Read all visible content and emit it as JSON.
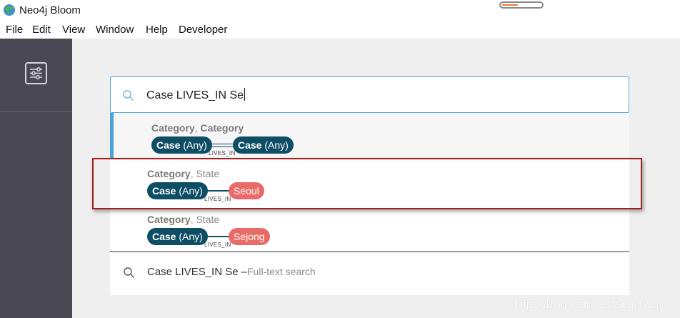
{
  "app": {
    "title": "Neo4j Bloom",
    "progress": 0.4
  },
  "menu": [
    "File",
    "Edit",
    "View",
    "Window",
    "Help",
    "Developer"
  ],
  "search": {
    "query": "Case LIVES_IN Se"
  },
  "suggestions": [
    {
      "label_bold": "Category",
      "label_sep": ", ",
      "label_rest": "Category",
      "rest_bold": true,
      "source": {
        "name": "Case",
        "qualifier": "(Any)"
      },
      "relationship": "LIVES_IN",
      "target": {
        "name": "Case",
        "qualifier": "(Any)"
      }
    },
    {
      "label_bold": "Category",
      "label_sep": ", ",
      "label_rest": "State",
      "rest_bold": false,
      "source": {
        "name": "Case",
        "qualifier": "(Any)"
      },
      "relationship": "LIVES_IN",
      "target_value": "Seoul"
    },
    {
      "label_bold": "Category",
      "label_sep": ", ",
      "label_rest": "State",
      "rest_bold": false,
      "source": {
        "name": "Case",
        "qualifier": "(Any)"
      },
      "relationship": "LIVES_IN",
      "target_value": "Sejong"
    }
  ],
  "fulltext": {
    "query": "Case LIVES_IN Se",
    "dash": "–",
    "hint": "Full-text search"
  },
  "watermark": "https://blog.csdn.net/GraphWay",
  "colors": {
    "node": "#0e4e64",
    "value": "#e96b67",
    "accent": "#4aa3d9",
    "highlight": "#a31f1f"
  }
}
